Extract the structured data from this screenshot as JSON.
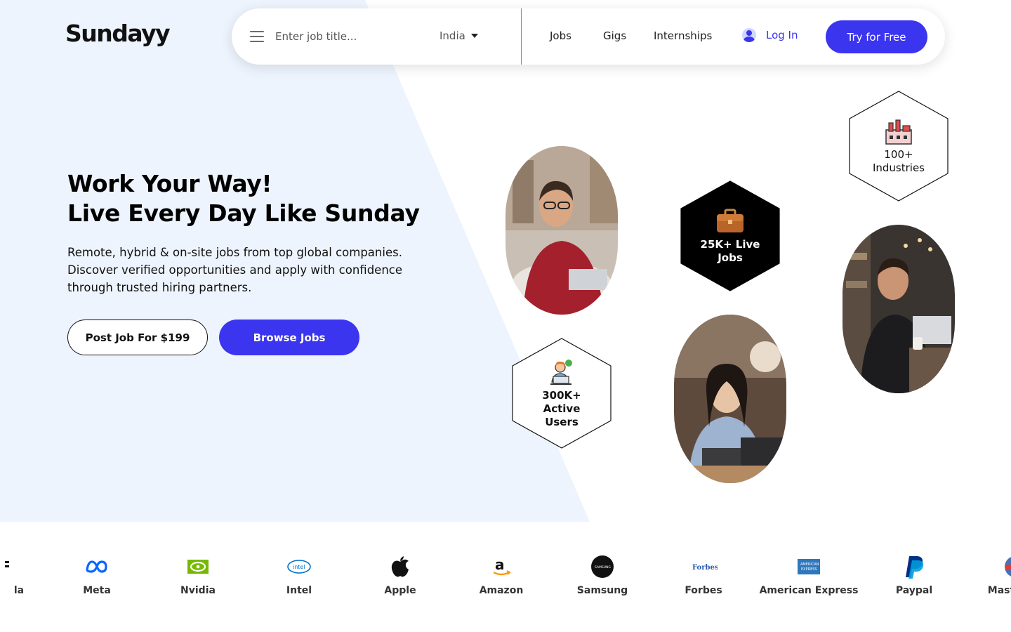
{
  "brand": {
    "logo": "Sundayy"
  },
  "nav": {
    "search_placeholder": "Enter job title...",
    "country": "India",
    "links": [
      "Jobs",
      "Gigs",
      "Internships"
    ],
    "login": "Log In",
    "cta": "Try for Free"
  },
  "hero": {
    "title_line1": "Work Your Way!",
    "title_line2": "Live Every Day Like Sunday",
    "description": "Remote, hybrid & on-site jobs from top global companies. Discover verified opportunities and apply with confidence through trusted hiring partners.",
    "btn_post": "Post Job For $199",
    "btn_browse": "Browse Jobs"
  },
  "stats": {
    "industries": {
      "line1": "100+",
      "line2": "Industries",
      "icon": "factory-icon"
    },
    "jobs": {
      "line1": "25K+ Live",
      "line2": "Jobs",
      "icon": "briefcase-icon"
    },
    "users": {
      "line1": "300K+",
      "line2": "Active",
      "line3": "Users",
      "icon": "user-laptop-icon"
    }
  },
  "companies": [
    {
      "name": "la",
      "icon": "partial-logo-icon"
    },
    {
      "name": "Meta",
      "icon": "meta-logo-icon"
    },
    {
      "name": "Nvidia",
      "icon": "nvidia-logo-icon"
    },
    {
      "name": "Intel",
      "icon": "intel-logo-icon"
    },
    {
      "name": "Apple",
      "icon": "apple-logo-icon"
    },
    {
      "name": "Amazon",
      "icon": "amazon-logo-icon"
    },
    {
      "name": "Samsung",
      "icon": "samsung-logo-icon"
    },
    {
      "name": "Forbes",
      "icon": "forbes-logo-icon"
    },
    {
      "name": "American Express",
      "icon": "amex-logo-icon"
    },
    {
      "name": "Paypal",
      "icon": "paypal-logo-icon"
    },
    {
      "name": "Mast",
      "icon": "mastercard-logo-icon"
    }
  ],
  "colors": {
    "accent": "#3b35f0",
    "background_wedge": "#eef4fd"
  }
}
